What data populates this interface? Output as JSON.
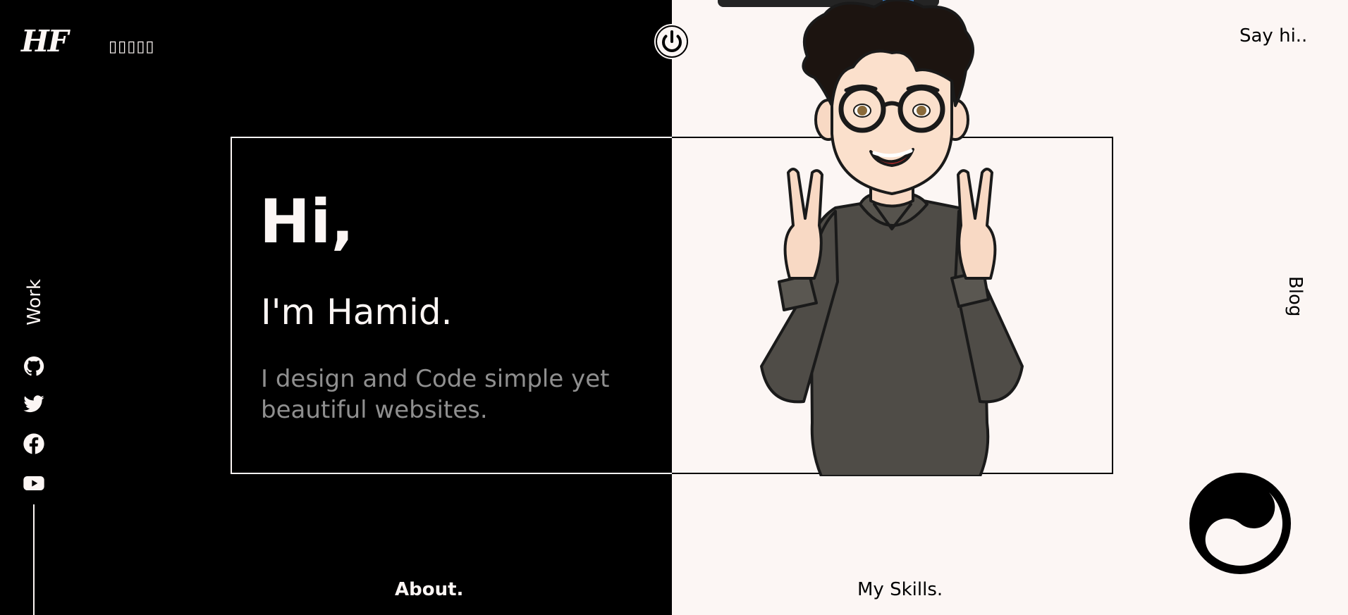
{
  "header": {
    "logo_text": "HF",
    "logo_subtext": "▯▯▯▯▯",
    "say_hi_label": "Say hi.."
  },
  "nav": {
    "work_label": "Work",
    "blog_label": "Blog",
    "about_label": "About.",
    "skills_label": "My Skills."
  },
  "intro": {
    "greeting": "Hi,",
    "name_line": "I'm Hamid.",
    "tagline": "I design and Code simple yet beautiful websites."
  },
  "social": {
    "icons": [
      "github-icon",
      "twitter-icon",
      "facebook-icon",
      "youtube-icon"
    ]
  },
  "theme": {
    "dark_color": "#000000",
    "light_color": "#fcf6f4",
    "muted_text": "#8f8f8f"
  }
}
